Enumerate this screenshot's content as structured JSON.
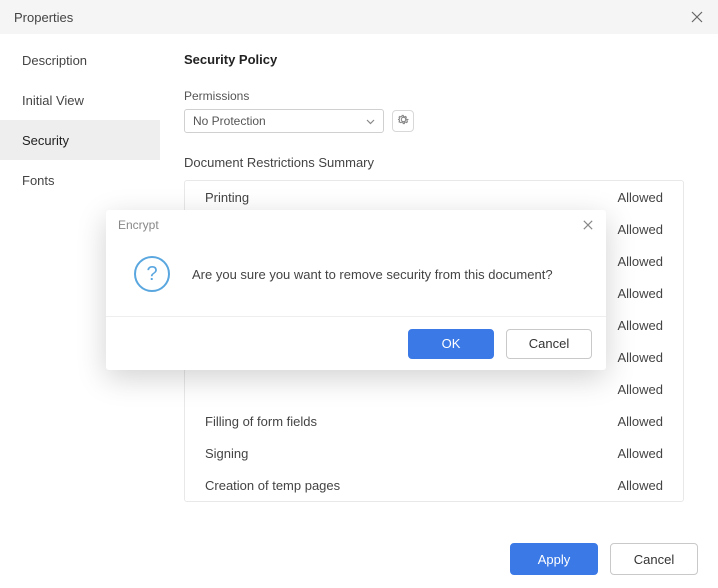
{
  "dialog": {
    "title": "Properties"
  },
  "sidebar": {
    "items": [
      {
        "label": "Description",
        "active": false
      },
      {
        "label": "Initial View",
        "active": false
      },
      {
        "label": "Security",
        "active": true
      },
      {
        "label": "Fonts",
        "active": false
      }
    ]
  },
  "content": {
    "section_title": "Security Policy",
    "permissions_label": "Permissions",
    "permissions_value": "No Protection",
    "restrictions_title": "Document Restrictions Summary",
    "restrictions": [
      {
        "name": "Printing",
        "status": "Allowed"
      },
      {
        "name": "",
        "status": "Allowed"
      },
      {
        "name": "",
        "status": "Allowed"
      },
      {
        "name": "",
        "status": "Allowed"
      },
      {
        "name": "",
        "status": "Allowed"
      },
      {
        "name": "",
        "status": "Allowed"
      },
      {
        "name": "",
        "status": "Allowed"
      },
      {
        "name": "Filling of form fields",
        "status": "Allowed"
      },
      {
        "name": "Signing",
        "status": "Allowed"
      },
      {
        "name": "Creation of temp pages",
        "status": "Allowed"
      }
    ]
  },
  "footer": {
    "apply_label": "Apply",
    "cancel_label": "Cancel"
  },
  "modal": {
    "title": "Encrypt",
    "message": "Are you sure you want to remove security from this document?",
    "ok_label": "OK",
    "cancel_label": "Cancel"
  }
}
